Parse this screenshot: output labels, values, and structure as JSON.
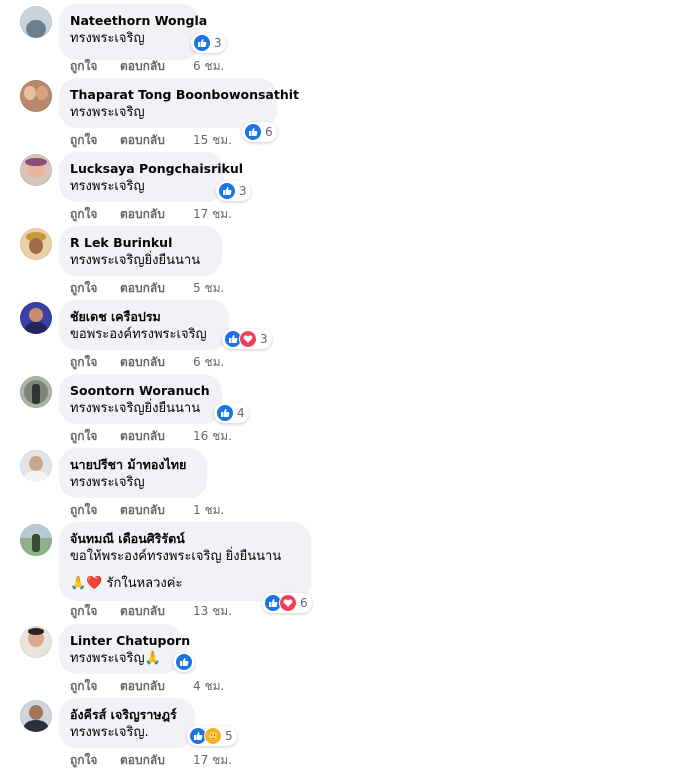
{
  "labels": {
    "like": "ถูกใจ",
    "reply": "ตอบกลับ"
  },
  "comments": [
    {
      "author": "Nateethorn Wongla",
      "text": "ทรงพระเจริญ",
      "reactions": [
        "like"
      ],
      "count": "3",
      "time": "6 ชม."
    },
    {
      "author": "Thaparat Tong Boonbowonsathit",
      "text": "ทรงพระเจริญ",
      "reactions": [
        "like"
      ],
      "count": "6",
      "time": "15 ชม."
    },
    {
      "author": "Lucksaya Pongchaisrikul",
      "text": "ทรงพระเจริญ",
      "reactions": [
        "like"
      ],
      "count": "3",
      "time": "17 ชม."
    },
    {
      "author": "R Lek Burinkul",
      "text": "ทรงพระเจริญยิ่งยืนนาน",
      "reactions": [],
      "count": "",
      "time": "5 ชม."
    },
    {
      "author": "ชัยเดช เครือปรม",
      "text": "ขอพระองค์ทรงพระเจริญ",
      "reactions": [
        "like",
        "love"
      ],
      "count": "3",
      "time": "6 ชม."
    },
    {
      "author": "Soontorn Woranuch",
      "text": "ทรงพระเจริญยิ่งยืนนาน",
      "reactions": [
        "like"
      ],
      "count": "4",
      "time": "16 ชม."
    },
    {
      "author": "นายปรีชา ม้าทองไทย",
      "text": "ทรงพระเจริญ",
      "reactions": [],
      "count": "",
      "time": "1 ชม."
    },
    {
      "author": "จันทมณี เดือนศิริรัตน์",
      "text": "ขอให้พระองค์ทรงพระเจริญ ยิ่งยืนนาน",
      "text2": "🙏❤️ รักในหลวงค่ะ",
      "reactions": [
        "like",
        "love"
      ],
      "count": "6",
      "time": "13 ชม."
    },
    {
      "author": "Linter Chatuporn",
      "text": "ทรงพระเจริญ🙏",
      "reactions": [
        "like"
      ],
      "count": "",
      "time": "4 ชม."
    },
    {
      "author": "อังคีรส์ เจริญราษฎร์",
      "text": "ทรงพระเจริญ.",
      "reactions": [
        "like",
        "care"
      ],
      "count": "5",
      "time": "17 ชม."
    }
  ]
}
